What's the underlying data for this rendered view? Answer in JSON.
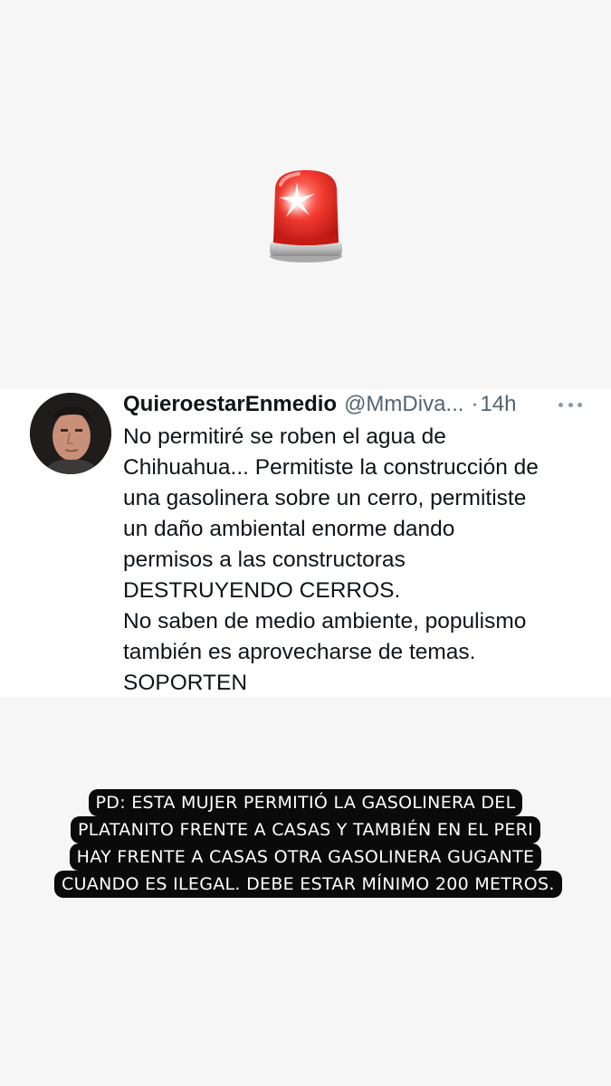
{
  "tweet": {
    "display_name": "QuieroestarEnmedio",
    "handle": "@MmDiva...",
    "separator": "·",
    "time": "14h",
    "lines": [
      "No permitiré se roben el agua de",
      "Chihuahua... Permitiste la construcción de",
      "una gasolinera sobre un cerro, permitiste",
      "un daño ambiental enorme dando",
      "permisos a las constructoras",
      "DESTRUYENDO CERROS.",
      "No saben de medio ambiente, populismo",
      "también es aprovecharse de temas.",
      "SOPORTEN"
    ]
  },
  "caption": {
    "lines": [
      "PD: ESTA MUJER PERMITIÓ LA GASOLINERA DEL",
      "PLATANITO FRENTE A CASAS Y TAMBIÉN EN EL PERI",
      "HAY FRENTE A CASAS OTRA GASOLINERA GUGANTE",
      "CUANDO ES ILEGAL. DEBE ESTAR MÍNIMO 200 METROS."
    ]
  },
  "colors": {
    "background": "#f6f6f6",
    "siren_red": "#e8302a",
    "caption_bg": "#0a0a0a",
    "caption_text": "#ffffff",
    "muted_text": "#536471"
  },
  "icons": {
    "sticker": "police-car-light-emoji",
    "more": "more-horizontal-icon"
  }
}
